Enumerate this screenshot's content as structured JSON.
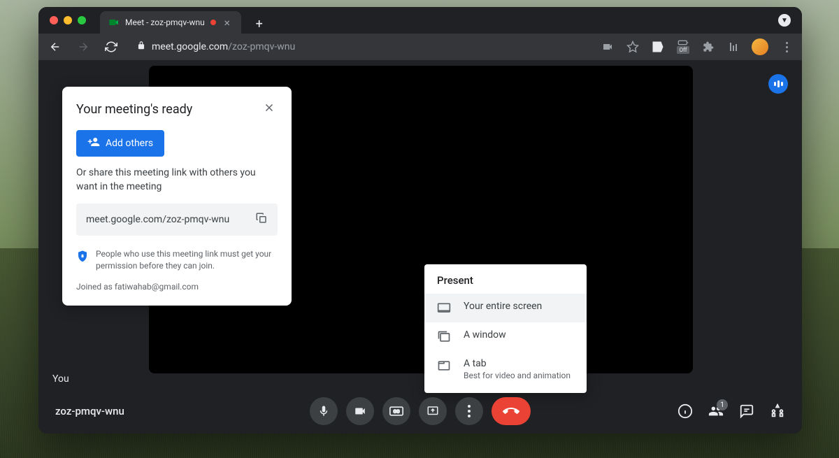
{
  "tab": {
    "title": "Meet - zoz-pmqv-wnu"
  },
  "url": {
    "domain": "meet.google.com",
    "path": "/zoz-pmqv-wnu"
  },
  "toolbar": {
    "off_label": "Off"
  },
  "video": {
    "self_label": "You"
  },
  "ready_panel": {
    "title": "Your meeting's ready",
    "add_button": "Add others",
    "share_text": "Or share this meeting link with others you want in the meeting",
    "link": "meet.google.com/zoz-pmqv-wnu",
    "permission_text": "People who use this meeting link must get your permission before they can join.",
    "joined_as": "Joined as fatiwahab@gmail.com"
  },
  "present": {
    "title": "Present",
    "options": [
      {
        "label": "Your entire screen"
      },
      {
        "label": "A window"
      },
      {
        "label": "A tab",
        "sublabel": "Best for video and animation"
      }
    ]
  },
  "footer": {
    "meeting_code": "zoz-pmqv-wnu",
    "people_count": "1"
  }
}
